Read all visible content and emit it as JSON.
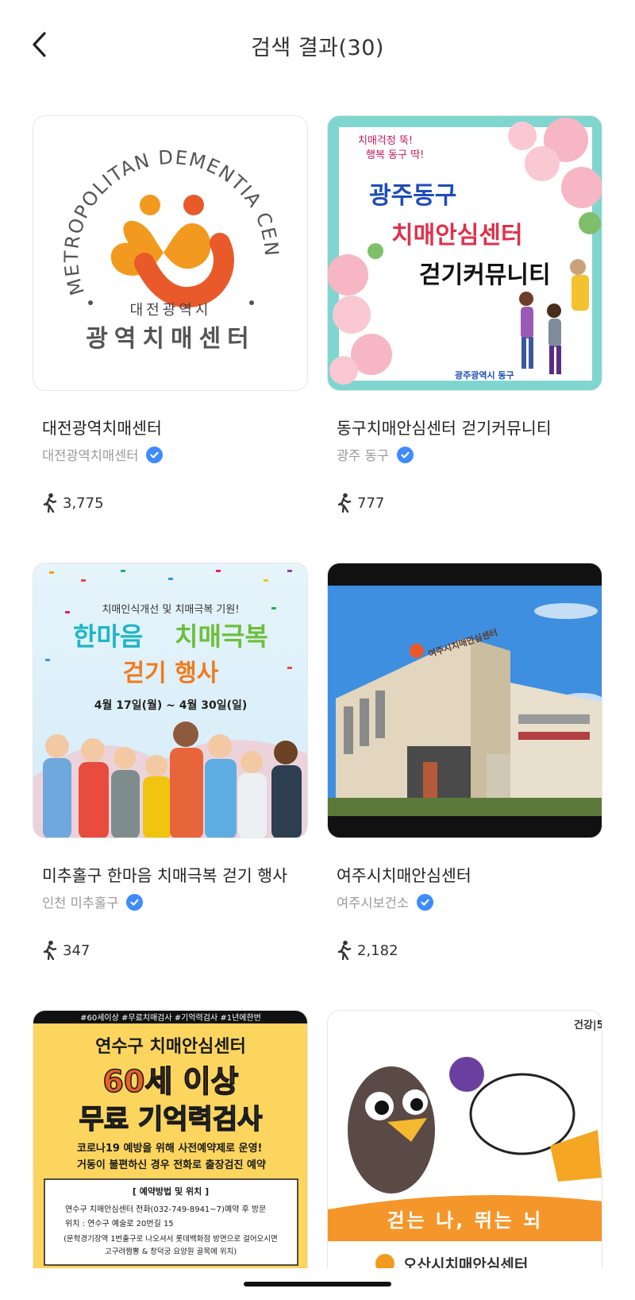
{
  "header": {
    "title": "검색 결과(30)"
  },
  "cards": [
    {
      "title": "대전광역치매센터",
      "org": "대전광역치매센터",
      "steps": "3,775",
      "image": {
        "ring_text": "METROPOLITAN DEMENTIA CENTER",
        "city": "대전광역시",
        "name": "광역치매센터"
      }
    },
    {
      "title": "동구치매안심센터 걷기커뮤니티",
      "org": "광주 동구",
      "steps": "777",
      "image": {
        "slogan1": "치매걱정 뚝!",
        "slogan2": "행복 동구 딱!",
        "line1": "광주동구",
        "line2": "치매안심센터",
        "line3": "걷기커뮤니티",
        "footer": "광주광역시 동구"
      }
    },
    {
      "title": "미추홀구 한마음 치매극복 걷기 행사",
      "org": "인천 미추홀구",
      "steps": "347",
      "image": {
        "sub": "치매인식개선 및 치매극복 기원!",
        "head_a": "한마음",
        "head_b": "치매극복",
        "head2": "걷기 행사",
        "dates": "4월 17일(월) ~ 4월 30일(일)"
      }
    },
    {
      "title": "여주시치매안심센터",
      "org": "여주시보건소",
      "steps": "2,182",
      "image": {
        "sign": "여주시치매안심센터"
      }
    },
    {
      "title": "",
      "org": "",
      "steps": "",
      "image": {
        "tags": "#60세이상 #무료치매검사 #기억력검사 #1년에한번",
        "head1": "연수구 치매안심센터",
        "head2": "60세 이상",
        "head3": "무료 기억력검사",
        "bullet1": "코로나19 예방을 위해 사전예약제로 운영!",
        "bullet2": "거동이 불편하신 경우 전화로 출장검진 예약",
        "box_title": "[ 예약방법 및 위치 ]",
        "box1": "연수구 치매안심센터 전화(032-749-8941~7)예약 후 방문",
        "box2": "위치 : 연수구 예술로 20번길 15",
        "box3": "(문학경기장역 1번출구로 나오셔서 롯데백화점 방면으로 걸어오시면",
        "box4": "고구려짬뽕 & 창덕궁 요양원 골목에 위치)"
      }
    },
    {
      "title": "",
      "org": "",
      "steps": "",
      "image": {
        "corner": "건강|5",
        "banner": "걷는 나, 뛰는 뇌",
        "footer": "오산시치매안심센터"
      }
    }
  ],
  "colors": {
    "verified": "#3d8bff",
    "logo_orange": "#f29a1f",
    "logo_red": "#e85a2a"
  },
  "icons": {
    "back": "chevron-left-icon",
    "verified": "check-badge-icon",
    "steps": "walking-person-icon"
  }
}
